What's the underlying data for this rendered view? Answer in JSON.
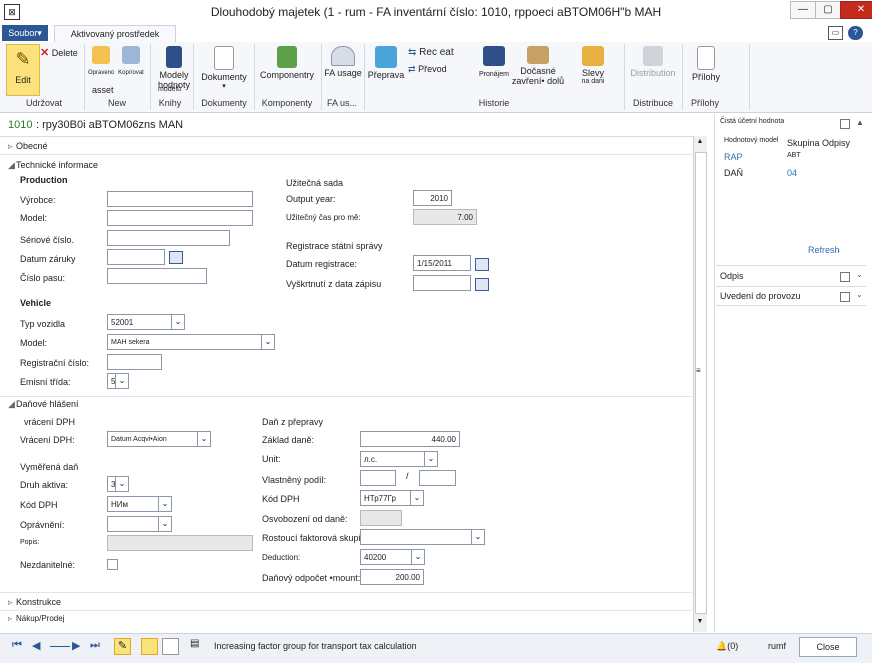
{
  "window": {
    "app_icon": "ax-icon",
    "title": "Dlouhodobý majetek (1 - rum - FA inventární číslo: 1010, rppoeci aBTOM06H\"b MAH",
    "buttons": {
      "min": "—",
      "max": "▢",
      "close": "✕"
    }
  },
  "tabs": {
    "file": "Soubor▾",
    "active": "Aktivovaný prostředek"
  },
  "ribbon": {
    "edit": "Edit",
    "delete": "Delete",
    "new_items": [
      "Opraveno",
      "Kopírovat",
      "asset"
    ],
    "value_models": "Modely hodnoty",
    "value_models_sub": "modelů",
    "documents": "Dokumenty",
    "components": "Componentry",
    "fa_usage": "FA usage",
    "transport": "Přeprava",
    "reclass": "Rec eat",
    "transfer": "Převod",
    "lease": "Pronájem",
    "partial_disposal": "Dočasné zavření• dolů",
    "discounts": "Slevy",
    "discounts_sub": "na dani",
    "distribution": "Distribution",
    "attachments": "Přílohy",
    "groups": {
      "maintain": "Udržovat",
      "new": "New",
      "books": "Knihy",
      "documents": "Dokumenty",
      "components": "Komponenty",
      "fa_usage": "FA us...",
      "history": "Historie",
      "distribution": "Distribuce",
      "attachments": "Přílohy"
    }
  },
  "record": {
    "id": "1010",
    "name": ": rpy30B0i aBTOM06zns MAN"
  },
  "sections": {
    "general": "Obecné",
    "tech_info": "Technické informace",
    "tax_reporting": "Daňové hlášení",
    "construction": "Konstrukce",
    "purchase_sale": "Nákup/Prodej"
  },
  "tech": {
    "production_title": "Production",
    "manufacturer_label": "Výrobce:",
    "model_label": "Model:",
    "serial_label": "Sériové číslo.",
    "warranty_label": "Datum záruky",
    "passport_label": "Číslo pasu:",
    "useful_title": "Užitečná sada",
    "output_year_label": "Output year:",
    "output_year_value": "2010",
    "useful_time_label": "Užitečný čas pro mě:",
    "useful_time_value": "7.00",
    "registration_title": "Registrace státní správy",
    "reg_date_label": "Datum registrace:",
    "reg_date_value": "1/15/2011",
    "dereg_label": "Vyškrtnutí z data zápisu",
    "vehicle_title": "Vehicle",
    "vehicle_type_label": "Typ vozidla",
    "vehicle_type_value": "52001",
    "vehicle_model_label": "Model:",
    "vehicle_model_value": "MAH sekera",
    "reg_number_label": "Registrační číslo:",
    "emission_label": "Emisní třída:",
    "emission_value": "5"
  },
  "tax": {
    "vat_refund_title": "vrácení DPH",
    "vat_refund_label": "Vrácení DPH:",
    "vat_refund_value": "Datum Acqvi•Aion",
    "assessed_title": "Vyměřená daň",
    "asset_type_label": "Druh aktiva:",
    "asset_type_value": "3",
    "vat_code_label": "Kód DPH",
    "vat_code_value": "НИм",
    "permission_label": "Oprávnění:",
    "description_label": "Popis:",
    "nondeductible_label": "Nezdanitelné:",
    "transport_tax_title": "Daň z přepravy",
    "tax_base_label": "Základ daně:",
    "tax_base_value": "440.00",
    "unit_label": "Unit:",
    "unit_value": "л.с.",
    "own_share_label": "Vlastněný podíl:",
    "share_sep": "/",
    "tt_vat_code_label": "Kód DPH",
    "tt_vat_code_value": "НТр77Гр",
    "exemption_label": "Osvobození od daně:",
    "factor_group_label": "Rostoucí faktorová skupina:",
    "deduction_label": "Deduction:",
    "deduction_value": "40200",
    "tax_deduction_label": "Daňový odpočet •mount:",
    "tax_deduction_value": "200.00"
  },
  "right_pane": {
    "title": "Čistá účetní hodnota",
    "col_model": "Hodnotový model",
    "col_group": "Skupina Odpisy",
    "rows": [
      {
        "model": "RAP",
        "group": "ABT"
      },
      {
        "model": "DAŇ",
        "group": "04"
      }
    ],
    "refresh": "Refresh",
    "depreciation": "Odpis",
    "commissioning": "Uvedení do provozu"
  },
  "status": {
    "help_text": "Increasing factor group for transport tax calculation",
    "notifications": "(0)",
    "user": "rumf",
    "close": "Close"
  },
  "colors": {
    "accent": "#2b5797",
    "edit_highlight": "#fbe27a",
    "id_green": "#2a7a2a",
    "link": "#2f6db5"
  }
}
